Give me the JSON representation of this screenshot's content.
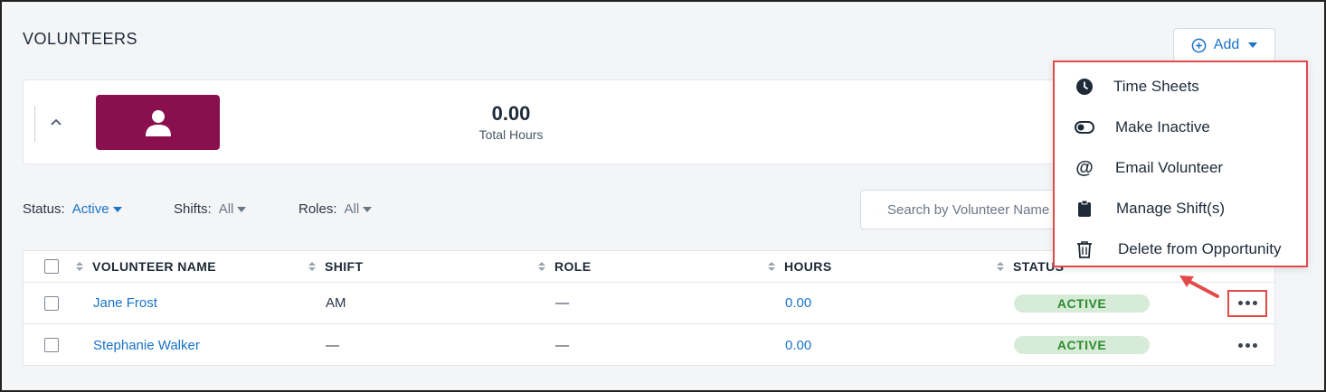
{
  "page": {
    "title": "VOLUNTEERS"
  },
  "add_button": {
    "label": "Add",
    "icon": "plus-circle-icon"
  },
  "summary": {
    "collapse_icon": "chevron-up-icon",
    "avatar_icon": "person-icon",
    "avatar_color": "#8a0f4e",
    "total_hours_value": "0.00",
    "total_hours_label": "Total Hours"
  },
  "filters": {
    "status": {
      "label": "Status:",
      "value": "Active"
    },
    "shifts": {
      "label": "Shifts:",
      "value": "All"
    },
    "roles": {
      "label": "Roles:",
      "value": "All"
    }
  },
  "search": {
    "placeholder": "Search by Volunteer Name"
  },
  "table": {
    "columns": [
      "VOLUNTEER NAME",
      "SHIFT",
      "ROLE",
      "HOURS",
      "STATUS"
    ],
    "rows": [
      {
        "name": "Jane Frost",
        "shift": "AM",
        "role": "—",
        "hours": "0.00",
        "status": "ACTIVE"
      },
      {
        "name": "Stephanie Walker",
        "shift": "—",
        "role": "—",
        "hours": "0.00",
        "status": "ACTIVE"
      }
    ]
  },
  "context_menu": {
    "items": [
      {
        "label": "Time Sheets",
        "icon": "clock-icon"
      },
      {
        "label": "Make Inactive",
        "icon": "toggle-icon"
      },
      {
        "label": "Email Volunteer",
        "icon": "at-sign-icon"
      },
      {
        "label": "Manage Shift(s)",
        "icon": "clipboard-icon"
      },
      {
        "label": "Delete from Opportunity",
        "icon": "trash-icon"
      }
    ]
  },
  "colors": {
    "accent": "#1a73c9",
    "highlight": "#e24a4a",
    "status_bg": "#d7ecd8",
    "status_text": "#2e8a2f"
  }
}
